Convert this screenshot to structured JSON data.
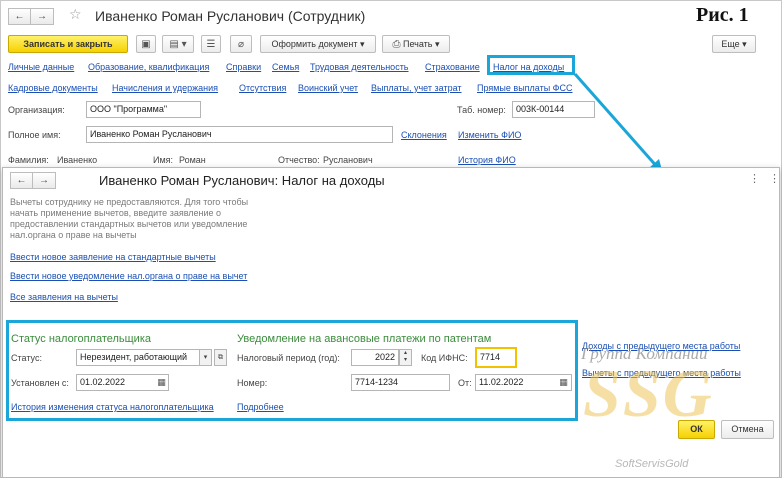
{
  "figure_label": "Рис. 1",
  "back_window": {
    "title": "Иваненко Роман Русланович (Сотрудник)",
    "toolbar": {
      "save_close": "Записать и закрыть",
      "create_doc": "Оформить документ",
      "print": "Печать",
      "more": "Еще"
    },
    "nav_links_row1": [
      "Личные данные",
      "Образование, квалификация",
      "Справки",
      "Семья",
      "Трудовая деятельность",
      "Страхование",
      "Налог на доходы"
    ],
    "nav_links_row2": [
      "Кадровые документы",
      "Начисления и удержания",
      "Отсутствия",
      "Воинский учет",
      "Выплаты, учет затрат",
      "Прямые выплаты ФСС"
    ],
    "org_label": "Организация:",
    "org_value": "ООО \"Программа\"",
    "tab_label": "Таб. номер:",
    "tab_value": "003К-00144",
    "fullname_label": "Полное имя:",
    "fullname_value": "Иваненко Роман Русланович",
    "declensions_link": "Склонения",
    "change_fio_link": "Изменить ФИО",
    "surname_label": "Фамилия:",
    "surname_value": "Иваненко",
    "name_label": "Имя:",
    "name_value": "Роман",
    "patronymic_label": "Отчество:",
    "patronymic_value": "Русланович",
    "history_fio_link": "История ФИО"
  },
  "front_window": {
    "title": "Иваненко Роман Русланович: Налог на доходы",
    "note_lines": [
      "Вычеты сотруднику не предоставляются. Для того чтобы",
      "начать применение вычетов, введите заявление о",
      "предоставлении стандартных вычетов или уведомление",
      "нал.органа о праве на вычеты"
    ],
    "link_new_application": "Ввести новое заявление на стандартные вычеты",
    "link_new_notice": "Ввести новое уведомление нал.органа о праве на вычет",
    "link_all_applications": "Все заявления на вычеты",
    "status_group_title": "Статус налогоплательщика",
    "status_label": "Статус:",
    "status_value": "Нерезидент, работающий",
    "established_label": "Установлен с:",
    "established_value": "01.02.2022",
    "status_history_link": "История изменения статуса налогоплательщика",
    "patent_group_title": "Уведомление на авансовые платежи по патентам",
    "tax_period_label": "Налоговый период (год):",
    "tax_period_value": "2022",
    "ifns_label": "Код ИФНС:",
    "ifns_value": "7714",
    "number_label": "Номер:",
    "number_value": "7714-1234",
    "from_label": "От:",
    "from_value": "11.02.2022",
    "more_link": "Подробнее",
    "income_prev_link": "Доходы с предыдущего места работы",
    "deductions_prev_link": "Вычеты с предыдущего места работы",
    "ok_button": "ОК",
    "cancel_button": "Отмена"
  },
  "watermark": {
    "top": "Группа Компаний",
    "logo": "SSG",
    "bottom": "SoftServisGold"
  },
  "colors": {
    "highlight": "#1aa6d8",
    "link": "#1b4fb3",
    "group_title": "#3c8c3c",
    "primary_button": "#f6d000"
  }
}
